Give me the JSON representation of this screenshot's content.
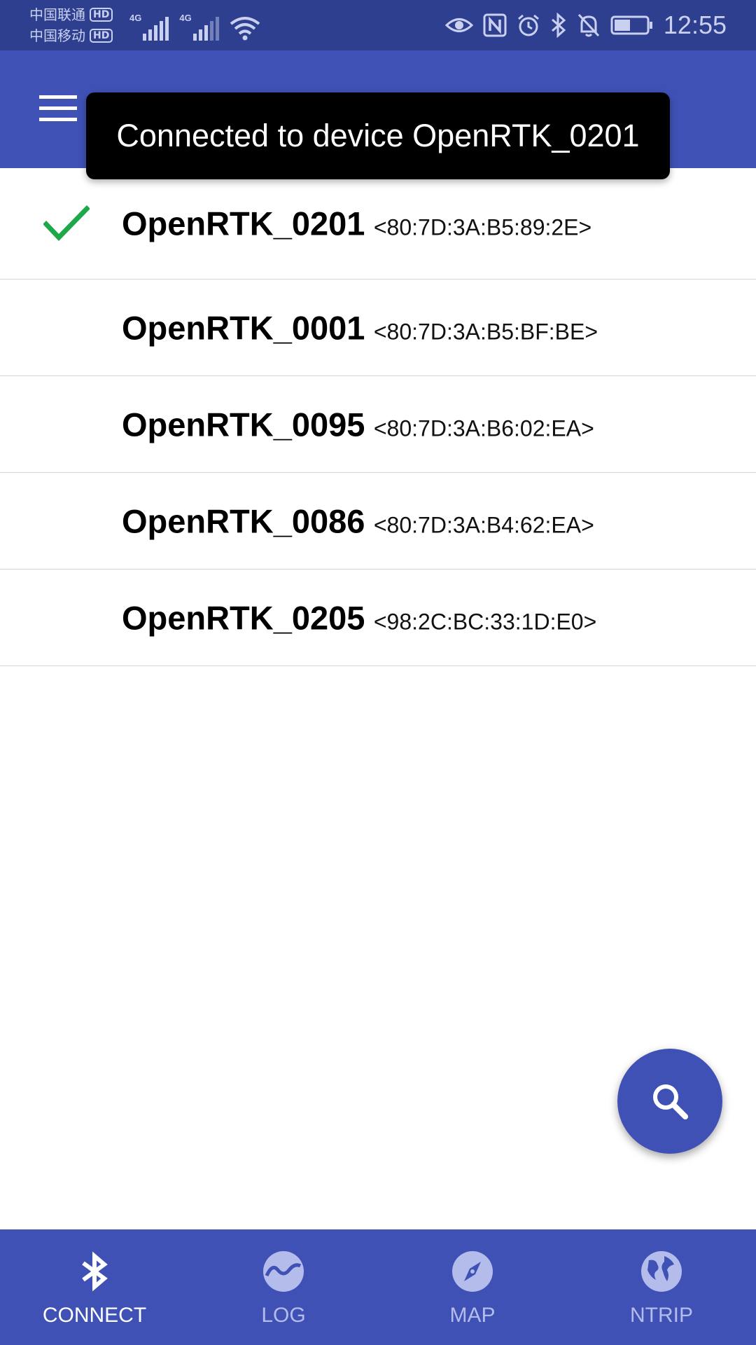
{
  "status_bar": {
    "carrier_1": "中国联通",
    "carrier_2": "中国移动",
    "hd_label": "HD",
    "network_type": "4G",
    "time": "12:55",
    "icons": [
      "eye-icon",
      "nfc-icon",
      "alarm-icon",
      "bluetooth-icon",
      "bell-off-icon",
      "battery-icon"
    ]
  },
  "app_bar": {
    "menu_icon": "hamburger-menu-icon"
  },
  "toast": {
    "message": "Connected to device OpenRTK_0201"
  },
  "devices": [
    {
      "name": "OpenRTK_0201",
      "mac": "<80:7D:3A:B5:89:2E>",
      "connected": true
    },
    {
      "name": "OpenRTK_0001",
      "mac": "<80:7D:3A:B5:BF:BE>",
      "connected": false
    },
    {
      "name": "OpenRTK_0095",
      "mac": "<80:7D:3A:B6:02:EA>",
      "connected": false
    },
    {
      "name": "OpenRTK_0086",
      "mac": "<80:7D:3A:B4:62:EA>",
      "connected": false
    },
    {
      "name": "OpenRTK_0205",
      "mac": "<98:2C:BC:33:1D:E0>",
      "connected": false
    }
  ],
  "fab": {
    "icon": "search-icon"
  },
  "bottom_nav": {
    "items": [
      {
        "label": "CONNECT",
        "icon": "bluetooth-icon",
        "active": true
      },
      {
        "label": "LOG",
        "icon": "waveform-icon",
        "active": false
      },
      {
        "label": "MAP",
        "icon": "compass-icon",
        "active": false
      },
      {
        "label": "NTRIP",
        "icon": "globe-icon",
        "active": false
      }
    ]
  },
  "colors": {
    "status_bar": "#2f3f8f",
    "primary": "#3f51b5",
    "check": "#1ea84a",
    "toast_bg": "#000000"
  }
}
